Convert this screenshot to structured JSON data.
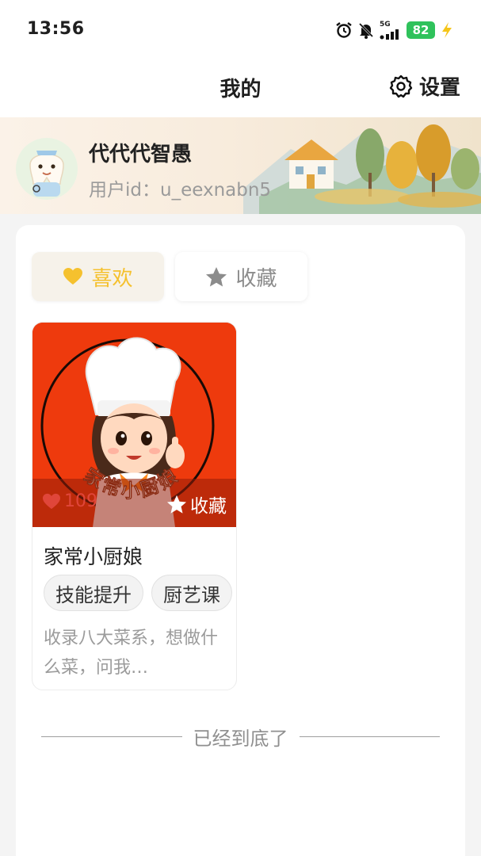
{
  "status_bar": {
    "time": "13:56",
    "network": "5G",
    "battery": "82",
    "icons": [
      "alarm-icon",
      "mute-bell-icon",
      "signal-icon",
      "battery-icon",
      "charging-icon"
    ]
  },
  "nav": {
    "title": "我的",
    "settings_label": "设置",
    "settings_icon": "gear-icon"
  },
  "profile": {
    "name": "代代代智愚",
    "user_id": "用户id：u_eexnabn5"
  },
  "tabs": [
    {
      "label": "喜欢",
      "icon": "heart-icon",
      "active": true
    },
    {
      "label": "收藏",
      "icon": "star-icon",
      "active": false
    }
  ],
  "items": [
    {
      "cover_text": "家常小厨娘",
      "likes": "109",
      "favorite_label": "收藏",
      "title": "家常小厨娘",
      "tags": [
        "技能提升",
        "厨艺课"
      ],
      "description": "收录八大菜系，想做什么菜，问我…"
    }
  ],
  "footer": {
    "end_text": "已经到底了"
  },
  "colors": {
    "accent": "#f5c12e",
    "cover_bg": "#ee3a0d",
    "battery": "#2fc25b"
  }
}
